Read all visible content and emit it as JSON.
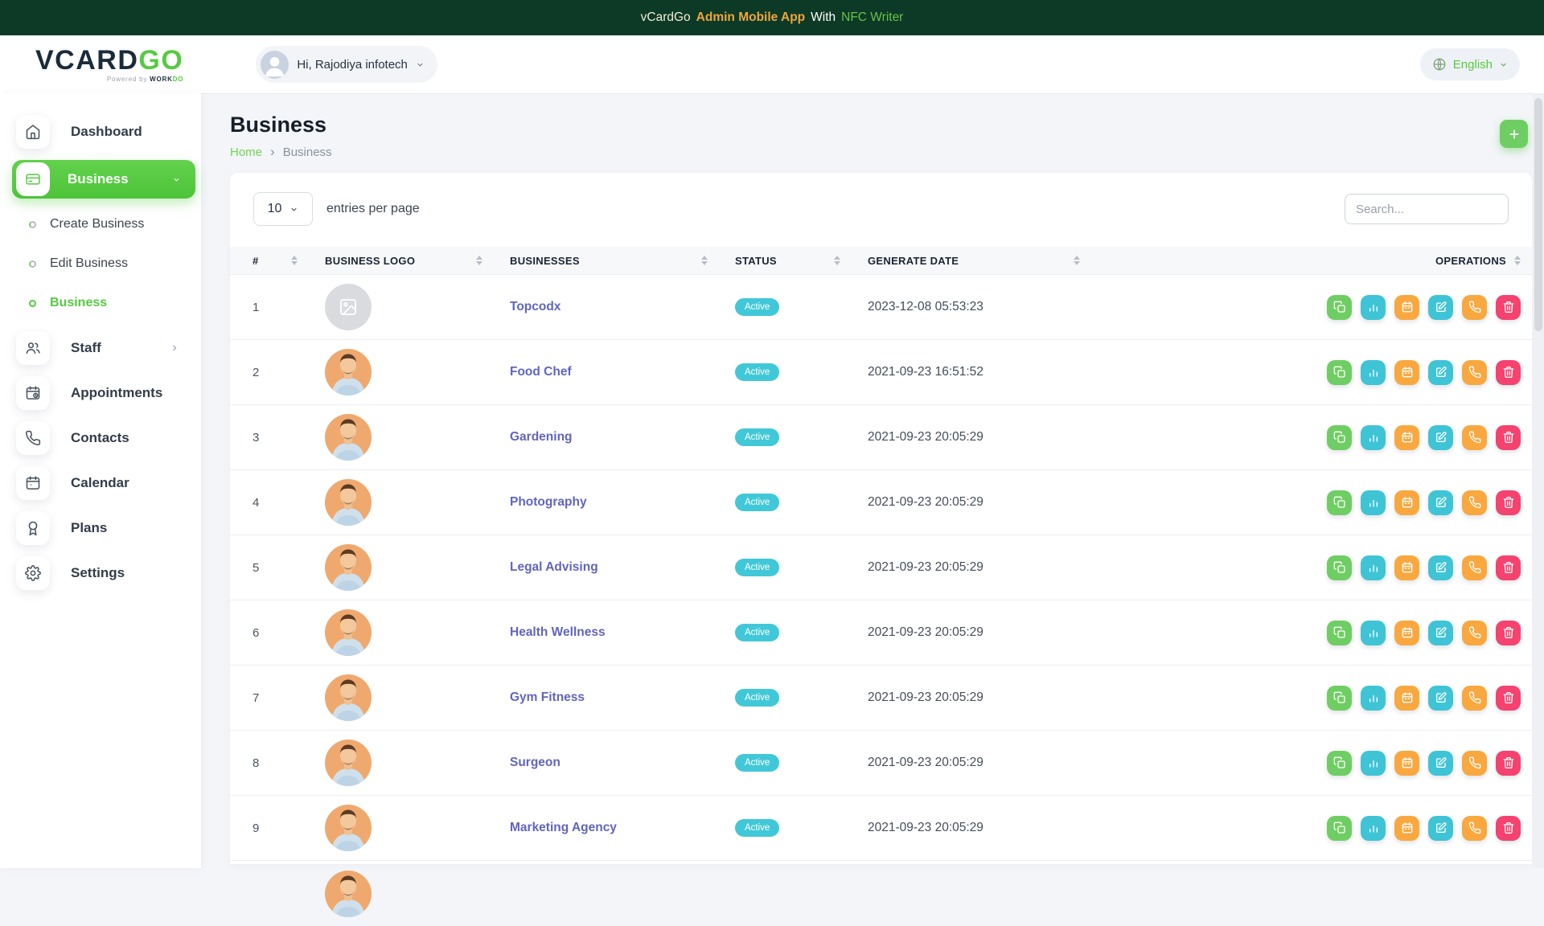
{
  "topbar": {
    "prefix": "vCardGo",
    "highlight": "Admin Mobile App",
    "connector": "With",
    "feature": "NFC Writer"
  },
  "header": {
    "logo_primary": "VCARD",
    "logo_accent": "GO",
    "tagline_prefix": "Powered by ",
    "tagline_brand": "WORK",
    "tagline_brand_accent": "DO",
    "user_greeting": "Hi, Rajodiya infotech",
    "language": "English"
  },
  "sidebar": {
    "items": [
      {
        "label": "Dashboard"
      },
      {
        "label": "Business"
      },
      {
        "label": "Create Business"
      },
      {
        "label": "Edit Business"
      },
      {
        "label": "Business"
      },
      {
        "label": "Staff"
      },
      {
        "label": "Appointments"
      },
      {
        "label": "Contacts"
      },
      {
        "label": "Calendar"
      },
      {
        "label": "Plans"
      },
      {
        "label": "Settings"
      }
    ]
  },
  "page": {
    "title": "Business",
    "breadcrumb_home": "Home",
    "breadcrumb_separator": "›",
    "breadcrumb_current": "Business"
  },
  "controls": {
    "entries_value": "10",
    "entries_label": "entries per page",
    "search_placeholder": "Search..."
  },
  "table": {
    "headers": [
      {
        "key": "num",
        "label": "#"
      },
      {
        "key": "business-logo",
        "label": "BUSINESS LOGO"
      },
      {
        "key": "businesses",
        "label": "BUSINESSES"
      },
      {
        "key": "status",
        "label": "STATUS"
      },
      {
        "key": "generate-date",
        "label": "GENERATE DATE"
      },
      {
        "key": "operations",
        "label": "OPERATIONS",
        "align": "right"
      }
    ],
    "rows": [
      {
        "number": "1",
        "logo": "placeholder",
        "name": "Topcodx",
        "status": "Active",
        "date": "2023-12-08 05:53:23"
      },
      {
        "number": "2",
        "logo": "photo",
        "name": "Food Chef",
        "status": "Active",
        "date": "2021-09-23 16:51:52"
      },
      {
        "number": "3",
        "logo": "photo",
        "name": "Gardening",
        "status": "Active",
        "date": "2021-09-23 20:05:29"
      },
      {
        "number": "4",
        "logo": "photo",
        "name": "Photography",
        "status": "Active",
        "date": "2021-09-23 20:05:29"
      },
      {
        "number": "5",
        "logo": "photo",
        "name": "Legal Advising",
        "status": "Active",
        "date": "2021-09-23 20:05:29"
      },
      {
        "number": "6",
        "logo": "photo",
        "name": "Health Wellness",
        "status": "Active",
        "date": "2021-09-23 20:05:29"
      },
      {
        "number": "7",
        "logo": "photo",
        "name": "Gym Fitness",
        "status": "Active",
        "date": "2021-09-23 20:05:29"
      },
      {
        "number": "8",
        "logo": "photo",
        "name": "Surgeon",
        "status": "Active",
        "date": "2021-09-23 20:05:29"
      },
      {
        "number": "9",
        "logo": "photo",
        "name": "Marketing Agency",
        "status": "Active",
        "date": "2021-09-23 20:05:29"
      }
    ],
    "operations": [
      {
        "name": "duplicate",
        "icon": "copy-icon",
        "color": "#6fce63"
      },
      {
        "name": "analytics",
        "icon": "bar-chart-icon",
        "color": "#3fc4d6"
      },
      {
        "name": "appointment",
        "icon": "calendar-icon",
        "color": "#f9a83f"
      },
      {
        "name": "edit",
        "icon": "edit-icon",
        "color": "#3fc4d6"
      },
      {
        "name": "contact",
        "icon": "phone-icon",
        "color": "#f9a83f"
      },
      {
        "name": "delete",
        "icon": "trash-icon",
        "color": "#f5426f"
      }
    ],
    "partial_row_visible": true
  },
  "colors": {
    "topbar_bg": "#0c3a26",
    "accent_green": "#56ca41",
    "link_indigo": "#6065be",
    "status_badge": "#41c8d8",
    "op_green": "#6fce63",
    "op_teal": "#3fc4d6",
    "op_orange": "#f9a83f",
    "op_pink": "#f5426f"
  }
}
